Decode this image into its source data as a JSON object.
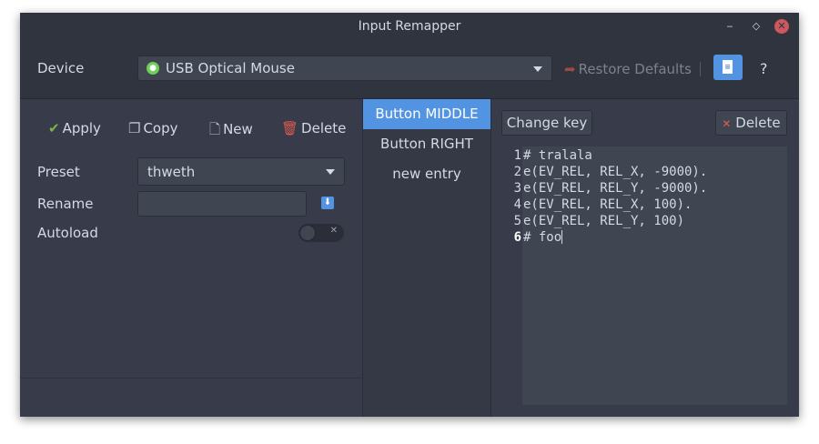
{
  "window": {
    "title": "Input Remapper",
    "min_glyph": "‒",
    "max_glyph": "◇",
    "close_glyph": "✕"
  },
  "header": {
    "device_label": "Device",
    "device_value": "USB Optical Mouse",
    "device_icon": "usb-lock-icon",
    "restore_label": "Restore Defaults",
    "restore_icon": "undo-arrow-icon",
    "docs_icon": "document-icon",
    "help_label": "?"
  },
  "toolbar": {
    "apply_label": "Apply",
    "copy_label": "Copy",
    "new_label": "New",
    "delete_label": "Delete"
  },
  "preset": {
    "preset_label": "Preset",
    "preset_value": "thweth",
    "rename_label": "Rename",
    "rename_value": "",
    "autoload_label": "Autoload",
    "autoload_on": false
  },
  "mappings": [
    {
      "label": "Button MIDDLE",
      "selected": true
    },
    {
      "label": "Button RIGHT",
      "selected": false
    },
    {
      "label": "new entry",
      "selected": false
    }
  ],
  "editor": {
    "change_key_label": "Change key",
    "delete_label": "Delete",
    "lines": [
      {
        "num": "1",
        "text": "# tralala"
      },
      {
        "num": "2",
        "text": "e(EV_REL, REL_X, -9000)."
      },
      {
        "num": "3",
        "text": "e(EV_REL, REL_Y, -9000)."
      },
      {
        "num": "4",
        "text": "e(EV_REL, REL_X, 100)."
      },
      {
        "num": "5",
        "text": "e(EV_REL, REL_Y, 100)"
      },
      {
        "num": "6",
        "text": "# foo"
      }
    ],
    "current_line": 6
  },
  "colors": {
    "accent": "#5294e2",
    "window_bg": "#383c4a",
    "header_bg": "#2f343f"
  }
}
